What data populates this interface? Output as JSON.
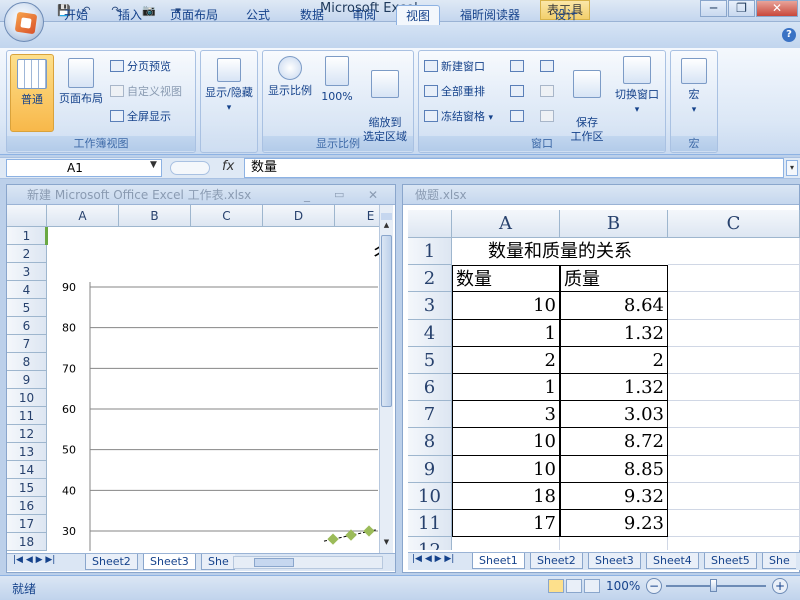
{
  "app": {
    "title": "Microsoft Excel",
    "tool_tab": "表工具"
  },
  "window_buttons": {
    "minimize": "─",
    "restore": "❐",
    "close": "✕"
  },
  "quick_access": {
    "save": "💾",
    "undo": "↶",
    "redo": "↷",
    "camera": "📷",
    "more": "▾"
  },
  "tabs": [
    "开始",
    "插入",
    "页面布局",
    "公式",
    "数据",
    "审阅",
    "视图",
    "福昕阅读器",
    "设计"
  ],
  "active_tab": "视图",
  "help": "?",
  "ribbon": {
    "groups": {
      "workbook_views": "工作簿视图",
      "zoom": "显示比例",
      "window": "窗口",
      "macro": "宏"
    },
    "buttons": {
      "normal": "普通",
      "page_layout": "页面布局",
      "page_break_preview": "分页预览",
      "custom_views": "自定义视图",
      "full_screen": "全屏显示",
      "show_hide": "显示/隐藏",
      "zoom": "显示比例",
      "zoom_100": "100%",
      "zoom_to_selection": "缩放到\n选定区域",
      "new_window": "新建窗口",
      "arrange_all": "全部重排",
      "freeze_panes": "冻结窗格",
      "save_workspace": "保存\n工作区",
      "switch_windows": "切换窗口",
      "macros": "宏"
    }
  },
  "formula_bar": {
    "cell_ref": "A1",
    "fx": "fx",
    "value": "数量"
  },
  "left_window": {
    "title": "新建 Microsoft Office Excel 工作表.xlsx",
    "columns": [
      "A",
      "B",
      "C",
      "D",
      "E"
    ],
    "rows": [
      "1",
      "2",
      "3",
      "4",
      "5",
      "6",
      "7",
      "8",
      "9",
      "10",
      "11",
      "12",
      "13",
      "14",
      "15",
      "16",
      "17",
      "18"
    ],
    "sheet_tabs": [
      "Sheet2",
      "Sheet3",
      "She"
    ],
    "active_sheet": "Sheet3",
    "title_fragment": "彳"
  },
  "chart_data": {
    "type": "scatter",
    "title": "",
    "xlabel": "",
    "ylabel": "",
    "ylim": [
      30,
      90
    ],
    "yticks": [
      30,
      40,
      50,
      60,
      70,
      80,
      90
    ],
    "grid": true,
    "series": [
      {
        "x": [
          1,
          2,
          3
        ],
        "y": [
          28,
          29,
          30
        ]
      }
    ]
  },
  "right_window": {
    "title": "做题.xlsx",
    "columns": [
      "A",
      "B",
      "C"
    ],
    "rows": [
      "1",
      "2",
      "3",
      "4",
      "5",
      "6",
      "7",
      "8",
      "9",
      "10",
      "11",
      "12"
    ],
    "table": {
      "title": "数量和质量的关系",
      "headers": [
        "数量",
        "质量"
      ],
      "data": [
        [
          "10",
          "8.64"
        ],
        [
          "1",
          "1.32"
        ],
        [
          "2",
          "2"
        ],
        [
          "1",
          "1.32"
        ],
        [
          "3",
          "3.03"
        ],
        [
          "10",
          "8.72"
        ],
        [
          "10",
          "8.85"
        ],
        [
          "18",
          "9.32"
        ],
        [
          "17",
          "9.23"
        ]
      ]
    },
    "sheet_tabs": [
      "Sheet1",
      "Sheet2",
      "Sheet3",
      "Sheet4",
      "Sheet5",
      "She"
    ],
    "active_sheet": "Sheet1"
  },
  "status": {
    "ready": "就绪",
    "zoom": "100%",
    "zoom_minus": "−",
    "zoom_plus": "+"
  }
}
